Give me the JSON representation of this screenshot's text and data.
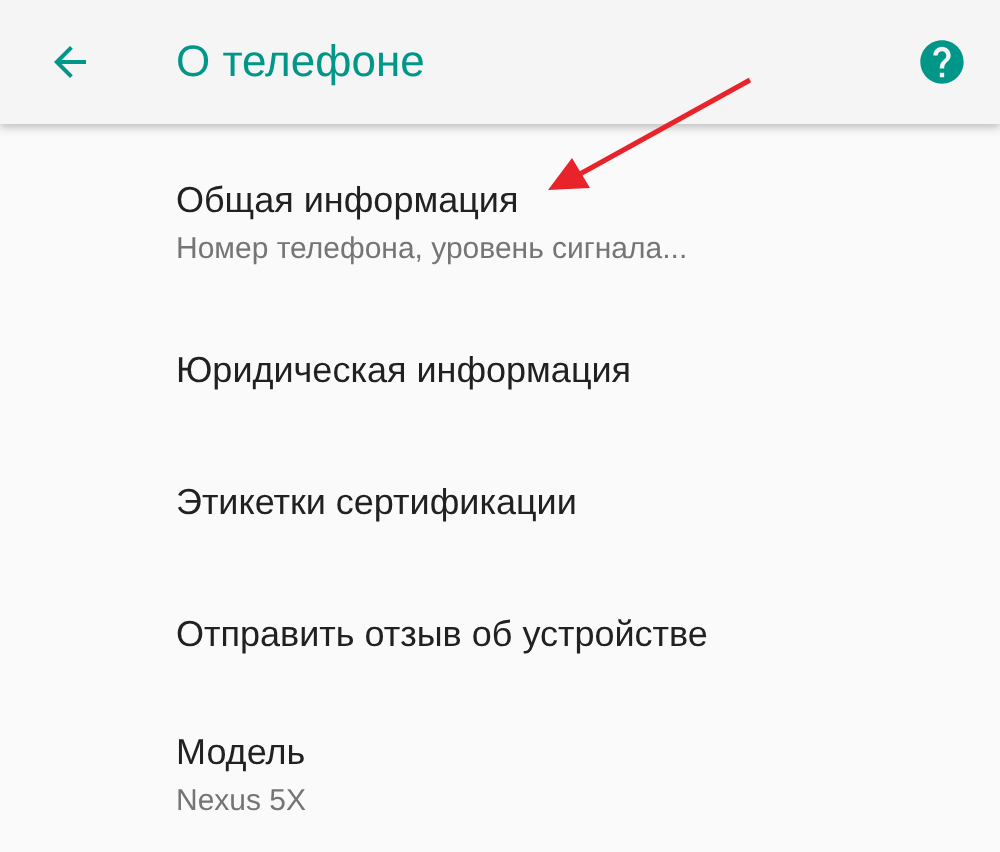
{
  "app_bar": {
    "title": "О телефоне"
  },
  "items": [
    {
      "title": "Общая информация",
      "subtitle": "Номер телефона, уровень сигнала..."
    },
    {
      "title": "Юридическая информация"
    },
    {
      "title": "Этикетки сертификации"
    },
    {
      "title": "Отправить отзыв об устройстве"
    },
    {
      "title": "Модель",
      "subtitle": "Nexus 5X"
    }
  ]
}
